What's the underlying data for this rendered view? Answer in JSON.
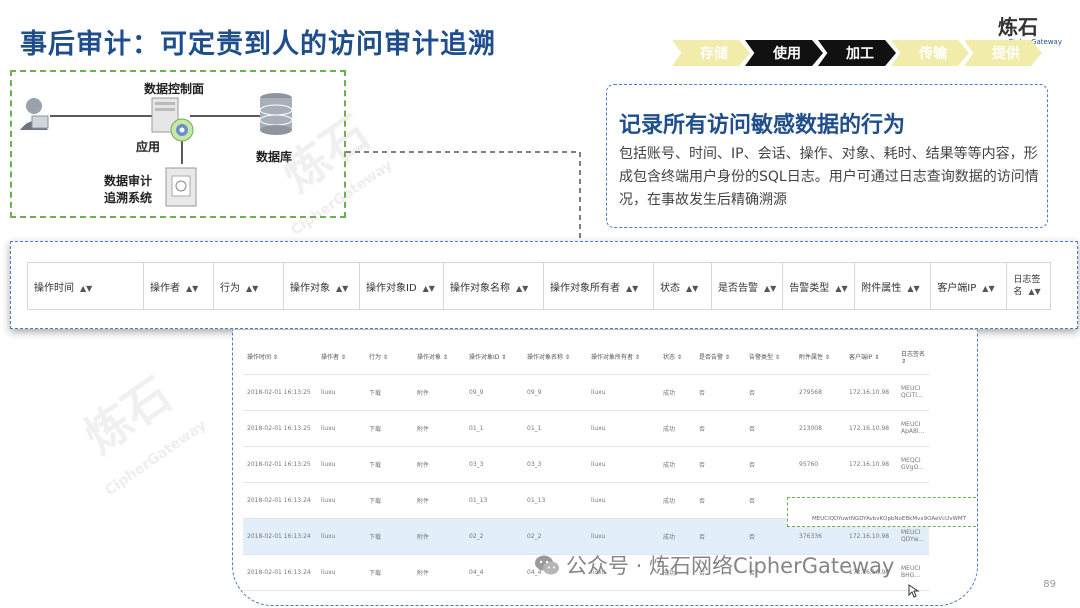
{
  "title": "事后审计：可定责到人的访问审计追溯",
  "logo": {
    "cn": "炼石",
    "en": "CipherGateway"
  },
  "steps": [
    {
      "label": "存储",
      "style": "light"
    },
    {
      "label": "使用",
      "style": "dark"
    },
    {
      "label": "加工",
      "style": "dark"
    },
    {
      "label": "传输",
      "style": "light"
    },
    {
      "label": "提供",
      "style": "light"
    }
  ],
  "arch": {
    "control_plane": "数据控制面",
    "app": "应用",
    "database": "数据库",
    "audit_system_l1": "数据审计",
    "audit_system_l2": "追溯系统"
  },
  "callout": {
    "heading": "记录所有访问敏感数据的行为",
    "body": "包括账号、时间、IP、会话、操作、对象、耗时、结果等等内容，形成包含终端用户身份的SQL日志。用户可通过日志查询数据的访问情况，在事故发生后精确溯源"
  },
  "columns": [
    "操作时间",
    "操作者",
    "行为",
    "操作对象",
    "操作对象ID",
    "操作对象名称",
    "操作对象所有者",
    "状态",
    "是否告警",
    "告警类型",
    "附件属性",
    "客户端IP",
    "日志签名"
  ],
  "table": {
    "headers": [
      "操作时间 ⇕",
      "操作者 ⇕",
      "行为 ⇕",
      "操作对象 ⇕",
      "操作对象ID ⇕",
      "操作对象名称 ⇕",
      "操作对象所有者 ⇕",
      "状态 ⇕",
      "是否告警 ⇕",
      "告警类型 ⇕",
      "附件属性 ⇕",
      "客户端IP ⇕",
      "日志签名 ⇕"
    ],
    "rows": [
      [
        "2018-02-01 16:13:25",
        "liuxu",
        "下载",
        "附件",
        "09_9",
        "09_9",
        "liuxu",
        "成功",
        "否",
        "否",
        "279568",
        "172.16.10.98",
        "MEUCI QCiTl..."
      ],
      [
        "2018-02-01 16:13:25",
        "liuxu",
        "下载",
        "附件",
        "01_1",
        "01_1",
        "liuxu",
        "成功",
        "否",
        "否",
        "213008",
        "172.16.10.98",
        "MEUCI ApA8l..."
      ],
      [
        "2018-02-01 16:13:25",
        "liuxu",
        "下载",
        "附件",
        "03_3",
        "03_3",
        "liuxu",
        "成功",
        "否",
        "否",
        "95760",
        "172.16.10.98",
        "MEQCI GVgO..."
      ],
      [
        "2018-02-01 16:13:24",
        "liuxu",
        "下载",
        "附件",
        "01_13",
        "01_13",
        "liuxu",
        "成功",
        "否",
        "否",
        "96794",
        "172.16.10.98",
        "MEUCI"
      ],
      [
        "2018-02-01 16:13:24",
        "liuxu",
        "下载",
        "附件",
        "02_2",
        "02_2",
        "liuxu",
        "成功",
        "否",
        "否",
        "376336",
        "172.16.10.98",
        "MEUCI QDYw..."
      ],
      [
        "2018-02-01 16:13:24",
        "liuxu",
        "下载",
        "附件",
        "04_4",
        "04_4",
        "liuxu",
        "成功",
        "否",
        "否",
        "",
        "172.16.10.98",
        "MEUCI BHG..."
      ]
    ],
    "selected_row": 4,
    "tooltip": "MEUCIQDYuwtNGDYAvbvKQpbNoEBkMvx9OAeVcUvWMT"
  },
  "watermark": {
    "cn": "炼石",
    "en": "CipherGateway"
  },
  "footer": {
    "text": "公众号 · 炼石网络CipherGateway"
  },
  "page_number": "89",
  "colors": {
    "title": "#1f4e8c",
    "dashed_green": "#6ab04c",
    "dashed_blue": "#4a7cc0",
    "step_light": "#f1ecaa",
    "step_dark": "#111111"
  }
}
